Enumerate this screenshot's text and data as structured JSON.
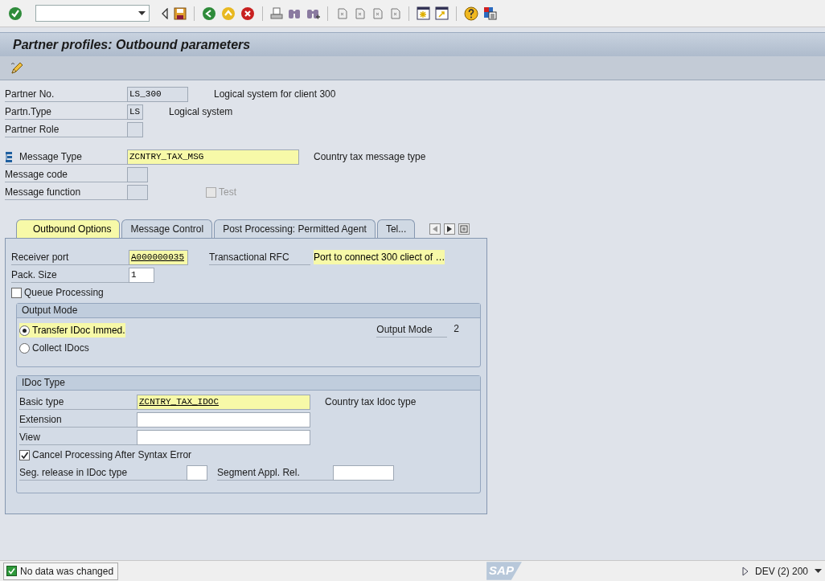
{
  "title": "Partner profiles: Outbound parameters",
  "partner_fields": [
    {
      "label": "Partner No.",
      "value": "LS_300",
      "description": "Logical system for client 300"
    },
    {
      "label": "Partn.Type",
      "value": "LS",
      "description": "Logical system"
    },
    {
      "label": "Partner Role"
    }
  ],
  "message_fields": [
    {
      "label": "Message Type",
      "value": "ZCNTRY_TAX_MSG",
      "description": "Country tax message type",
      "highlighted": true
    },
    {
      "label": "Message code",
      "highlighted": false
    },
    {
      "label": "Message function",
      "highlighted": false
    }
  ],
  "test_checkbox": {
    "label": "Test",
    "checked": false,
    "disabled": true
  },
  "tabs": [
    {
      "label": "Outbound Options",
      "selected": true,
      "highlighted": true
    },
    {
      "label": "Message Control",
      "selected": false,
      "highlighted": false
    },
    {
      "label": "Post Processing: Permitted Agent",
      "selected": false,
      "highlighted": false
    },
    {
      "label": "Tel...",
      "selected": false,
      "highlighted": false
    }
  ],
  "receiver_port": {
    "label": "Receiver port",
    "value": "A000000035",
    "port_type": "Transactional RFC",
    "description": "Port to connect 300 cliect of …",
    "highlighted": true
  },
  "pack_size": {
    "label": "Pack. Size",
    "value": "1"
  },
  "queue_processing": {
    "label": "Queue Processing",
    "checked": false
  },
  "output_mode": {
    "title": "Output Mode",
    "options": [
      {
        "label": "Transfer IDoc Immed.",
        "selected": true,
        "highlighted": true
      },
      {
        "label": "Collect IDocs",
        "selected": false,
        "highlighted": false
      }
    ],
    "mode_label": "Output Mode",
    "mode_value": "2"
  },
  "idoc_type": {
    "title": "IDoc Type",
    "fields": [
      {
        "label": "Basic type",
        "value": "ZCNTRY_TAX_IDOC",
        "description": "Country tax Idoc type",
        "highlighted": true
      },
      {
        "label": "Extension",
        "highlighted": false
      },
      {
        "label": "View",
        "highlighted": false
      }
    ],
    "cancel_processing": {
      "label": "Cancel Processing After Syntax Error",
      "checked": true
    },
    "seg_release": {
      "label": "Seg. release in IDoc type"
    },
    "segment_appl_rel": {
      "label": "Segment Appl. Rel."
    }
  },
  "status_bar": {
    "message": "No data was changed",
    "logo": "SAP",
    "system": "DEV (2) 200"
  }
}
